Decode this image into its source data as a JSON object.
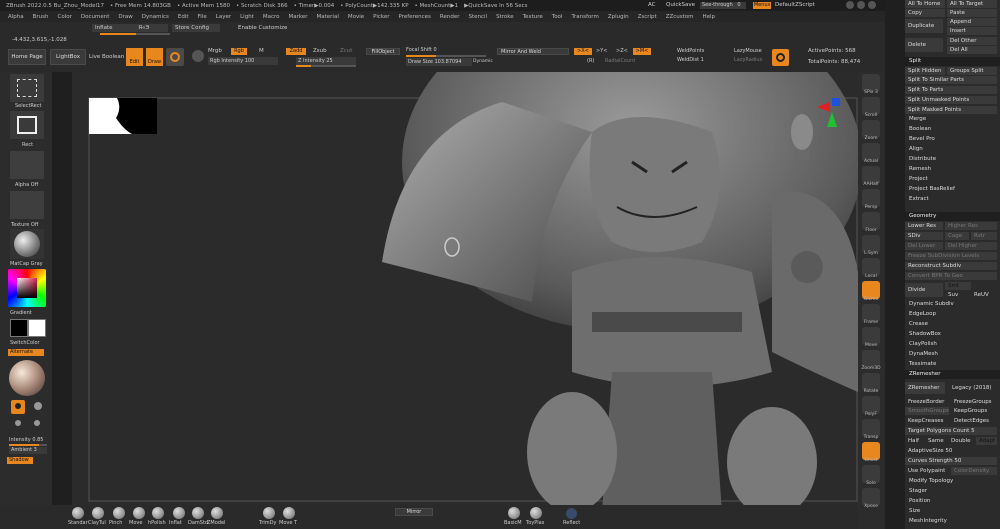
{
  "titlebar": {
    "app": "ZBrush 2022.0.5 Bu_Zhou_Model17",
    "free_mem": "• Free Mem 14.803GB",
    "active_mem": "• Active Mem 1580",
    "scratch": "• Scratch Disk 366",
    "timer": "• Timer▶0.004",
    "polycount": "• PolyCount▶142.335 KP",
    "meshcount": "• MeshCount▶1",
    "quicksave": "▶QuickSave In 56 Secs",
    "ac": "AC",
    "quicksave_btn": "QuickSave",
    "seethrough": "See-through",
    "seethrough_val": "0",
    "menus": "Menus",
    "default_zscript": "DefaultZScript"
  },
  "menubar": [
    "Alpha",
    "Brush",
    "Color",
    "Document",
    "Draw",
    "Dynamics",
    "Edit",
    "File",
    "Layer",
    "Light",
    "Macro",
    "Marker",
    "Material",
    "Movie",
    "Picker",
    "Preferences",
    "Render",
    "Stencil",
    "Stroke",
    "Texture",
    "Tool",
    "Transform",
    "Zplugin",
    "Zscript",
    "ZZcustom",
    "Help"
  ],
  "toolbar2": {
    "inflate": "Inflate",
    "inflate_val": "Я«Э",
    "store_config": "Store Config",
    "enable_customize": "Enable Customize",
    "coords": "-4.432,3.615,-1.028"
  },
  "toolbar3": {
    "home_page": "Home Page",
    "lightbox": "LightBox",
    "live_boolean": "Live Boolean",
    "edit": "Edit",
    "draw": "Draw",
    "mrgb": "Mrgb",
    "rgb": "Rgb",
    "m": "M",
    "zadd": "Zadd",
    "zsub": "Zsub",
    "zcut": "Zcut",
    "rgb_intensity": "Rgb Intensity 100",
    "z_intensity": "Z Intensity 25",
    "fill_object": "FillObject",
    "focal_shift": "Focal Shift 0",
    "draw_size": "Draw Size 103.87094",
    "dynamic": "Dynamic",
    "mirror_weld": "Mirror And Weld",
    "x_sym": ">X<",
    "y_sym": ">Y<",
    "z_sym": ">Z<",
    "m_sym": ">M<",
    "r": "(R)",
    "radial_count": "RadialCount",
    "weld_points": "WeldPoints",
    "weld_dist": "WeldDist 1",
    "lazy_mouse": "LazyMouse",
    "lazy_radius": "LazyRadius",
    "active_points": "ActivePoints: 568",
    "total_points": "TotalPoints: 88,474"
  },
  "leftshelf": {
    "select_rect": "SelectRect",
    "rect": "Rect",
    "alpha_off": "Alpha Off",
    "texture_off": "Texture Off",
    "matcap": "MatCap Gray",
    "gradient": "Gradient",
    "switch_color": "SwitchColor",
    "alternate": "Alternate",
    "intensity": "Intensity 0.85",
    "ambient": "Ambient 3",
    "shadow": "Shadow"
  },
  "rightshelf": [
    "SPix 3",
    "Scroll",
    "Zoom",
    "Actual",
    "AAHalf",
    "Persp",
    "Floor",
    "L.Sym",
    "Local",
    "Gizmo",
    "Frame",
    "Move",
    "Zoom3D",
    "Rotate",
    "PolyF",
    "Transp",
    "Ghost",
    "Solo",
    "Xpose"
  ],
  "bottomshelf": {
    "brushes": [
      "Standar",
      "ClayTul",
      "Pinch",
      "Move",
      "hPolish",
      "Inflat",
      "DamStd",
      "ZModel",
      "TrimDy",
      "Move T"
    ],
    "mirror": "Mirror",
    "right_brushes": [
      "BasicM",
      "ToyPlas"
    ],
    "reflect": "Reflect"
  },
  "panel": {
    "top": {
      "all_to_home": "All To Home",
      "all_to_target": "All To Target",
      "copy": "Copy",
      "paste": "Paste",
      "duplicate": "Duplicate",
      "append": "Append",
      "insert": "Insert",
      "delete": "Delete",
      "del_other": "Del Other",
      "del_all": "Del All"
    },
    "split": {
      "title": "Split",
      "items": [
        "Split Hidden",
        "Groups Split",
        "Split To Similar Parts",
        "Split To Parts",
        "Split Unmasked Points",
        "Split Masked Points"
      ]
    },
    "subtools": [
      "Merge",
      "Boolean",
      "Bevel Pro",
      "Align",
      "Distribute",
      "Remesh",
      "Project",
      "Project BasRelief",
      "Extract"
    ],
    "geometry": {
      "title": "Geometry",
      "lower_res": "Lower Res",
      "higher_res": "Higher Res",
      "sdiv": "SDiv",
      "cage": "Cage",
      "rstr": "Rstr",
      "del_lower": "Del Lower",
      "del_higher": "Del Higher",
      "freeze_subdiv": "Freeze SubDivision Levels",
      "reconstruct": "Reconstruct Subdiv",
      "convert_bpr": "Convert BPR To Geo",
      "divide": "Divide",
      "smt": "Smt",
      "suv": "Suv",
      "reuv": "ReUV",
      "items": [
        "Dynamic Subdiv",
        "EdgeLoop",
        "Crease",
        "ShadowBox",
        "ClayPolish",
        "DynaMesh",
        "Tessimate"
      ]
    },
    "zremesher": {
      "title": "ZRemesher",
      "zremesher": "ZRemesher",
      "legacy": "Legacy (2018)",
      "freeze_border": "FreezeBorder",
      "freeze_groups": "FreezeGroups",
      "smooth_groups": "SmoothGroups",
      "keep_groups": "KeepGroups",
      "keep_creases": "KeepCreases",
      "detect_edges": "DetectEdges",
      "target_poly": "Target Polygons Count 5",
      "half": "Half",
      "same": "Same",
      "double": "Double",
      "adapt": "Adapt",
      "adaptive_size": "AdaptiveSize 50",
      "curves_strength": "Curves Strength 50",
      "use_polypaint": "Use Polypaint",
      "color_density": "ColorDensity"
    },
    "bottom": [
      "Modify Topology",
      "Stager",
      "Position",
      "Size",
      "MeshIntegrity"
    ]
  },
  "colors": {
    "accent": "#e8871e",
    "panel_bg": "#2b2b2b",
    "canvas_bg": "#2b2b2b"
  }
}
